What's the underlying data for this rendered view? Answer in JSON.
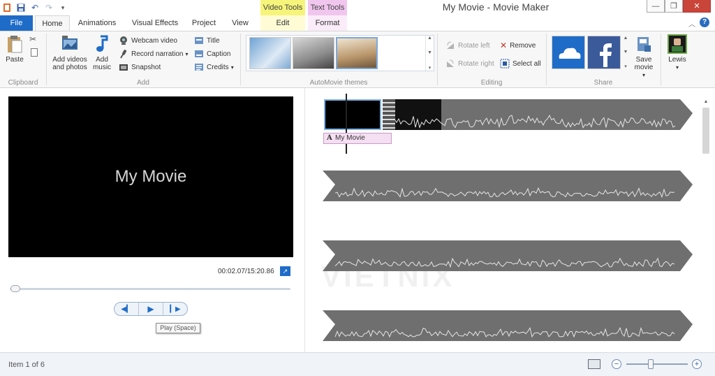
{
  "window": {
    "title": "My Movie - Movie Maker"
  },
  "context_tabs": {
    "video_tools": "Video Tools",
    "text_tools": "Text Tools"
  },
  "tabs": [
    {
      "label": "File"
    },
    {
      "label": "Home"
    },
    {
      "label": "Animations"
    },
    {
      "label": "Visual Effects"
    },
    {
      "label": "Project"
    },
    {
      "label": "View"
    },
    {
      "label": "Edit"
    },
    {
      "label": "Format"
    }
  ],
  "ribbon": {
    "clipboard": {
      "label": "Clipboard",
      "paste": "Paste"
    },
    "add": {
      "label": "Add",
      "add_videos_line1": "Add videos",
      "add_videos_line2": "and photos",
      "add_music_line1": "Add",
      "add_music_line2": "music",
      "webcam": "Webcam video",
      "narration": "Record narration",
      "snapshot": "Snapshot",
      "title": "Title",
      "caption": "Caption",
      "credits": "Credits"
    },
    "themes": {
      "label": "AutoMovie themes"
    },
    "editing": {
      "label": "Editing",
      "rotate_left": "Rotate left",
      "rotate_right": "Rotate right",
      "remove": "Remove",
      "select_all": "Select all"
    },
    "share": {
      "label": "Share",
      "save_line1": "Save",
      "save_line2": "movie"
    },
    "account": {
      "name": "Lewis"
    }
  },
  "preview": {
    "title_text": "My Movie",
    "timecode": "00:02.07/15:20.86",
    "progress": 0.002,
    "tooltip": "Play (Space)"
  },
  "storyboard": {
    "caption_chip": "My Movie"
  },
  "watermark": "VIETNIX",
  "status": {
    "text": "Item 1 of 6"
  },
  "colors": {
    "file_tab": "#1f6cc8",
    "video_tools": "#f6f47a",
    "text_tools": "#f1c6ee",
    "close": "#c9453a"
  }
}
